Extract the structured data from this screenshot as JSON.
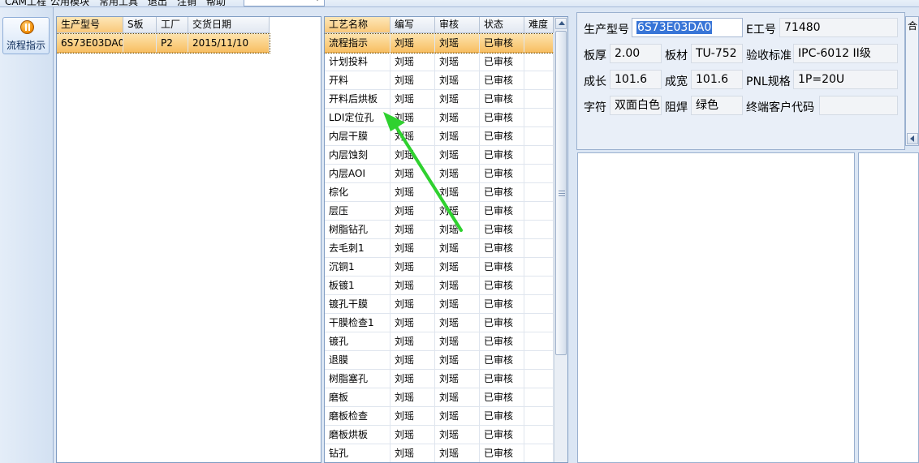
{
  "menubar": {
    "items": [
      "CAM工程",
      "公用模块",
      "常用工具",
      "退出",
      "注销",
      "帮助"
    ]
  },
  "leftnav": {
    "flow_button_label": "流程指示"
  },
  "order_grid": {
    "columns": [
      "生产型号",
      "S板",
      "工厂",
      "交货日期"
    ],
    "rows": [
      [
        "6S73E03DA0",
        "",
        "P2",
        "2015/11/10"
      ]
    ]
  },
  "process_grid": {
    "columns": [
      "工艺名称",
      "编写",
      "审核",
      "状态",
      "难度"
    ],
    "rows": [
      [
        "流程指示",
        "刘瑶",
        "刘瑶",
        "已审核",
        ""
      ],
      [
        "计划投料",
        "刘瑶",
        "刘瑶",
        "已审核",
        ""
      ],
      [
        "开料",
        "刘瑶",
        "刘瑶",
        "已审核",
        ""
      ],
      [
        "开料后烘板",
        "刘瑶",
        "刘瑶",
        "已审核",
        ""
      ],
      [
        "LDI定位孔",
        "刘瑶",
        "刘瑶",
        "已审核",
        ""
      ],
      [
        "内层干膜",
        "刘瑶",
        "刘瑶",
        "已审核",
        ""
      ],
      [
        "内层蚀刻",
        "刘瑶",
        "刘瑶",
        "已审核",
        ""
      ],
      [
        "内层AOI",
        "刘瑶",
        "刘瑶",
        "已审核",
        ""
      ],
      [
        "棕化",
        "刘瑶",
        "刘瑶",
        "已审核",
        ""
      ],
      [
        "层压",
        "刘瑶",
        "刘瑶",
        "已审核",
        ""
      ],
      [
        "树脂钻孔",
        "刘瑶",
        "刘瑶",
        "已审核",
        ""
      ],
      [
        "去毛刺1",
        "刘瑶",
        "刘瑶",
        "已审核",
        ""
      ],
      [
        "沉铜1",
        "刘瑶",
        "刘瑶",
        "已审核",
        ""
      ],
      [
        "板镀1",
        "刘瑶",
        "刘瑶",
        "已审核",
        ""
      ],
      [
        "镀孔干膜",
        "刘瑶",
        "刘瑶",
        "已审核",
        ""
      ],
      [
        "干膜检查1",
        "刘瑶",
        "刘瑶",
        "已审核",
        ""
      ],
      [
        "镀孔",
        "刘瑶",
        "刘瑶",
        "已审核",
        ""
      ],
      [
        "退膜",
        "刘瑶",
        "刘瑶",
        "已审核",
        ""
      ],
      [
        "树脂塞孔",
        "刘瑶",
        "刘瑶",
        "已审核",
        ""
      ],
      [
        "磨板",
        "刘瑶",
        "刘瑶",
        "已审核",
        ""
      ],
      [
        "磨板检查",
        "刘瑶",
        "刘瑶",
        "已审核",
        ""
      ],
      [
        "磨板烘板",
        "刘瑶",
        "刘瑶",
        "已审核",
        ""
      ],
      [
        "钻孔",
        "刘瑶",
        "刘瑶",
        "已审核",
        ""
      ]
    ]
  },
  "details": {
    "model_label": "生产型号",
    "model_value": "6S73E03DA0",
    "ejob_label": "E工号",
    "ejob_value": "71480",
    "thickness_label": "板厚",
    "thickness_value": "2.00",
    "material_label": "板材",
    "material_value": "TU-752",
    "standard_label": "验收标准",
    "standard_value": "IPC-6012 II级",
    "length_label": "成长",
    "length_value": "101.6",
    "width_label": "成宽",
    "width_value": "101.6",
    "pnl_label": "PNL规格",
    "pnl_value": "1P=20U",
    "legend_label": "字符",
    "legend_value": "双面白色",
    "mask_label": "阻焊",
    "mask_value": "绿色",
    "customer_label": "终端客户代码",
    "customer_value": ""
  },
  "side_panel": {
    "tab_label": "合"
  },
  "colors": {
    "selection_orange": "#f8bf63",
    "header_orange": "#f9c87a",
    "annotation_arrow": "#2fd12f",
    "field_highlight": "#3875d7"
  },
  "icons": {
    "flow_button_icon": "pause-circle-icon",
    "annotation": "green-arrow-icon"
  }
}
